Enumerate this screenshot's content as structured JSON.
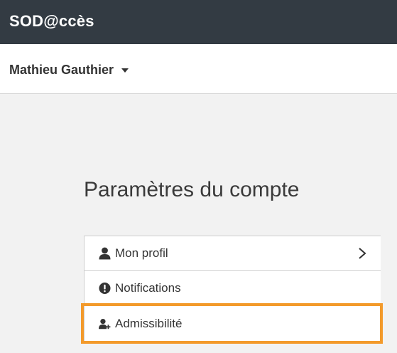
{
  "app": {
    "title": "SOD@ccès"
  },
  "user_menu": {
    "name": "Mathieu Gauthier",
    "icon": "caret-down-icon"
  },
  "page": {
    "title": "Paramètres du compte"
  },
  "menu": {
    "items": [
      {
        "label": "Mon profil",
        "icon": "user-icon",
        "chevron": "chevron-right-icon"
      },
      {
        "label": "Notifications",
        "icon": "exclamation-circle-icon"
      },
      {
        "label": "Admissibilité",
        "icon": "user-plus-icon",
        "highlighted": true
      }
    ]
  },
  "colors": {
    "header_bg": "#333b43",
    "highlight": "#f39a2b",
    "text": "#333333",
    "background": "#f2f2f2"
  }
}
